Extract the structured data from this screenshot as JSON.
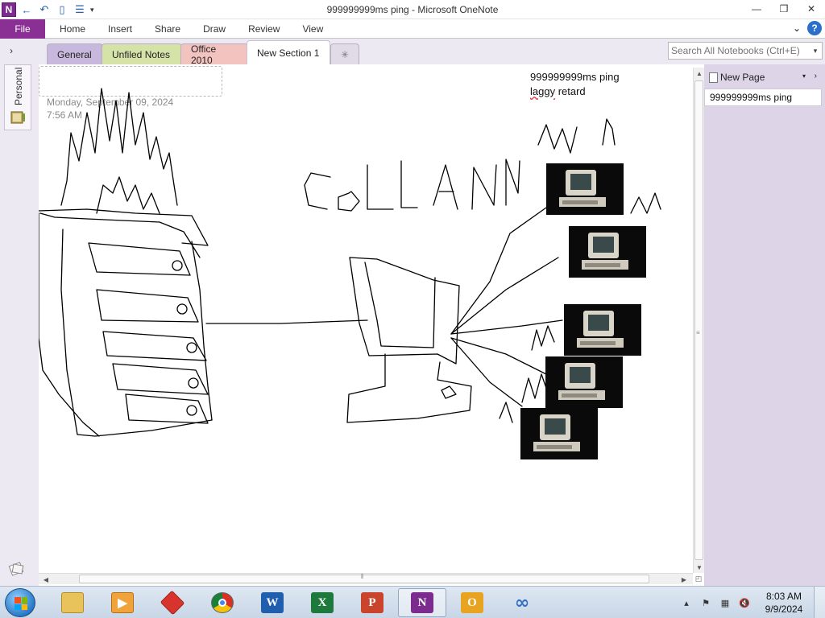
{
  "window": {
    "title": "999999999ms ping - Microsoft OneNote",
    "app_logo": "N",
    "controls": {
      "minimize": "—",
      "restore": "❐",
      "close": "✕"
    }
  },
  "qat": {
    "back_icon": "←",
    "undo_icon": "↶",
    "dock_icon": "▯",
    "fullpage_icon": "☰",
    "customize": "▾"
  },
  "ribbon": {
    "file_label": "File",
    "tabs": [
      "Home",
      "Insert",
      "Share",
      "Draw",
      "Review",
      "View"
    ],
    "minimize_caret": "⌄",
    "help": "?"
  },
  "sections": {
    "toggle": "›",
    "tabs": [
      "General",
      "Unfiled Notes",
      "Office 2010",
      "New Section 1"
    ],
    "add_tab": "✳",
    "colors": {
      "General": "#c8b8dd",
      "Unfiled Notes": "#d5e3a8",
      "Office 2010": "#f3c3c0"
    }
  },
  "search": {
    "placeholder": "Search All Notebooks (Ctrl+E)",
    "drop": "▾"
  },
  "notebook": {
    "name": "Personal"
  },
  "page": {
    "date": "Monday, September 09, 2024",
    "time": "7:56 AM",
    "note_line1": "999999999ms  ping",
    "note_line2_word1": "laggy",
    "note_line2_word2": "retard"
  },
  "pages_pane": {
    "new_page": "New Page",
    "caret": "▾",
    "chevron": "›",
    "pages": [
      "999999999ms ping"
    ]
  },
  "scroll": {
    "up": "▲",
    "down": "▼",
    "left": "◀",
    "right": "▶",
    "vgrip": "≡",
    "hgrip": "⦀"
  },
  "taskbar": {
    "apps": [
      {
        "name": "explorer",
        "glyph": ""
      },
      {
        "name": "media-player",
        "glyph": "▶"
      },
      {
        "name": "toolbox",
        "glyph": ""
      },
      {
        "name": "chrome",
        "glyph": ""
      },
      {
        "name": "word",
        "glyph": "W"
      },
      {
        "name": "excel",
        "glyph": "X"
      },
      {
        "name": "powerpoint",
        "glyph": "P"
      },
      {
        "name": "onenote",
        "glyph": "N"
      },
      {
        "name": "outlook",
        "glyph": "O"
      },
      {
        "name": "infinity",
        "glyph": "∞"
      }
    ],
    "tray": {
      "arrow": "▴",
      "flag": "⚑",
      "network": "▦",
      "volume": "🔇"
    },
    "clock_time": "8:03 AM",
    "clock_date": "9/9/2024"
  }
}
